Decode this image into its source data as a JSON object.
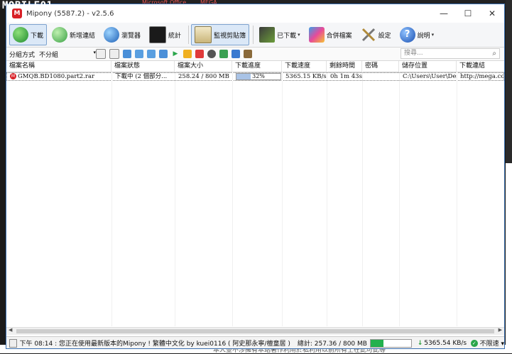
{
  "overlay": {
    "site_logo": "MOBILE01"
  },
  "background": {
    "ghost_tab_1": "Microsoft Office",
    "ghost_tab_2": "MEGA",
    "bottom_text": "本人並不涉擁有本站著作利用於私利用以前所有上在此可此等"
  },
  "window": {
    "app_initial": "M",
    "title": "Mipony (5587.2) - v2.5.6",
    "minimize": "—",
    "maximize": "☐",
    "close": "✕"
  },
  "toolbar": {
    "download": "下載",
    "add_link": "新增連結",
    "browser": "瀏覽器",
    "stats": "統計",
    "monitor_clipboard": "監視剪貼簿",
    "downloaded": "已下載",
    "merge_files": "合併檔案",
    "settings": "設定",
    "help": "說明",
    "help_glyph": "?",
    "dropdown_glyph": "▾"
  },
  "subtoolbar": {
    "group_label": "分組方式",
    "group_value": "不分組",
    "search_placeholder": "搜尋...",
    "search_glyph": "⌕"
  },
  "table": {
    "headers": [
      "檔案名稱",
      "檔案狀態",
      "檔案大小",
      "下載進度",
      "下載速度",
      "剩餘時間",
      "密碼",
      "儲存位置",
      "下載連結"
    ],
    "rows": [
      {
        "name": "GMQB.BD1080.part2.rar",
        "status": "下載中 (2 個部分...",
        "size": "258.24 / 800 MB",
        "progress_label": "32%",
        "progress": 32,
        "speed": "5365.15 KB/s",
        "remaining": "0h 1m 43s",
        "password": "",
        "location": "C:\\Users\\User\\Des...",
        "link": "http://mega.co.nz/#"
      }
    ]
  },
  "status": {
    "message": "下午 08:14 : 您正在使用最新版本的Mipony ! 繁體中文化 by kuei0116 ( 阿史那永寧/檀童居 )",
    "total_label": "總計: 257.36 / 800 MB",
    "total_progress": 32,
    "speed": "5365.54 KB/s",
    "limit": "不限速",
    "limit_caret": "▾"
  },
  "colors": {
    "accent": "#3a6fb0",
    "progress_fill": "#a9c3e6",
    "status_fill": "#23b14d",
    "mega_red": "#d81f26"
  }
}
